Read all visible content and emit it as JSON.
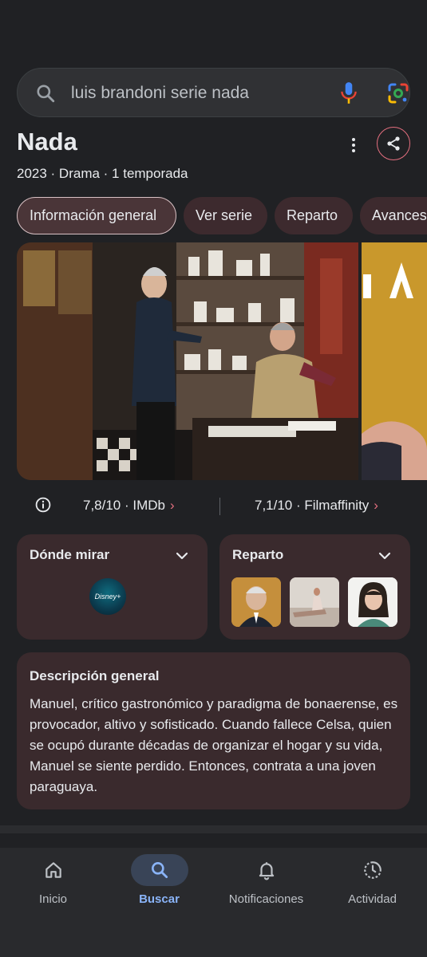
{
  "search": {
    "query": "luis brandoni serie nada"
  },
  "entity": {
    "title": "Nada",
    "meta": "2023 · Drama · 1 temporada"
  },
  "chips": [
    "Información general",
    "Ver serie",
    "Reparto",
    "Avances"
  ],
  "ratings": [
    {
      "text": "7,8/10 · IMDb"
    },
    {
      "text": "7,1/10 · Filmaffinity"
    }
  ],
  "where_to_watch": {
    "title": "Dónde mirar",
    "provider": "Disney+"
  },
  "cast": {
    "title": "Reparto"
  },
  "description": {
    "title": "Descripción general",
    "text": "Manuel, crítico gastronómico y paradigma de bonaerense, es provocador, altivo y sofisticado. Cuando fallece Celsa, quien se ocupó durante décadas de organizar el hogar y su vida, Manuel se siente perdido. Entonces, contrata a una joven paraguaya."
  },
  "bottom_nav": [
    {
      "label": "Inicio",
      "icon": "home-icon"
    },
    {
      "label": "Buscar",
      "icon": "search-icon"
    },
    {
      "label": "Notificaciones",
      "icon": "bell-icon"
    },
    {
      "label": "Actividad",
      "icon": "activity-icon"
    }
  ],
  "colors": {
    "accent": "#e46f7f",
    "card": "#3a2a2d",
    "nav_active": "#8ab4f8"
  }
}
